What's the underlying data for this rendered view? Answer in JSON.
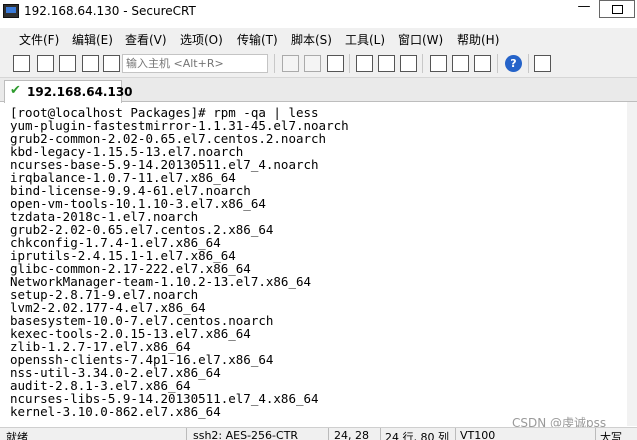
{
  "window": {
    "title": "192.168.64.130 - SecureCRT",
    "minimize": "—"
  },
  "menu": {
    "items": [
      "文件(F)",
      "编辑(E)",
      "查看(V)",
      "选项(O)",
      "传输(T)",
      "脚本(S)",
      "工具(L)",
      "窗口(W)",
      "帮助(H)"
    ]
  },
  "toolbar": {
    "host_placeholder": "输入主机 <Alt+R>",
    "help_label": "?"
  },
  "tabs": [
    {
      "label": "192.168.64.130",
      "status_icon": "check-icon",
      "status_color": "#2e9b2e"
    }
  ],
  "terminal": {
    "lines": [
      "[root@localhost Packages]# rpm -qa | less",
      "yum-plugin-fastestmirror-1.1.31-45.el7.noarch",
      "grub2-common-2.02-0.65.el7.centos.2.noarch",
      "kbd-legacy-1.15.5-13.el7.noarch",
      "ncurses-base-5.9-14.20130511.el7_4.noarch",
      "irqbalance-1.0.7-11.el7.x86_64",
      "bind-license-9.9.4-61.el7.noarch",
      "open-vm-tools-10.1.10-3.el7.x86_64",
      "tzdata-2018c-1.el7.noarch",
      "grub2-2.02-0.65.el7.centos.2.x86_64",
      "chkconfig-1.7.4-1.el7.x86_64",
      "iprutils-2.4.15.1-1.el7.x86_64",
      "glibc-common-2.17-222.el7.x86_64",
      "NetworkManager-team-1.10.2-13.el7.x86_64",
      "setup-2.8.71-9.el7.noarch",
      "lvm2-2.02.177-4.el7.x86_64",
      "basesystem-10.0-7.el7.centos.noarch",
      "kexec-tools-2.0.15-13.el7.x86_64",
      "zlib-1.2.7-17.el7.x86_64",
      "openssh-clients-7.4p1-16.el7.x86_64",
      "nss-util-3.34.0-2.el7.x86_64",
      "audit-2.8.1-3.el7.x86_64",
      "ncurses-libs-5.9-14.20130511.el7_4.x86_64",
      "kernel-3.10.0-862.el7.x86_64"
    ]
  },
  "status": {
    "ready": "就绪",
    "protocol": "ssh2: AES-256-CTR",
    "position": "24,  28",
    "rows_cols": "24 行, 80 列",
    "terminal_type": "VT100",
    "caps": "大写"
  },
  "watermark": "CSDN @虔诚pss"
}
